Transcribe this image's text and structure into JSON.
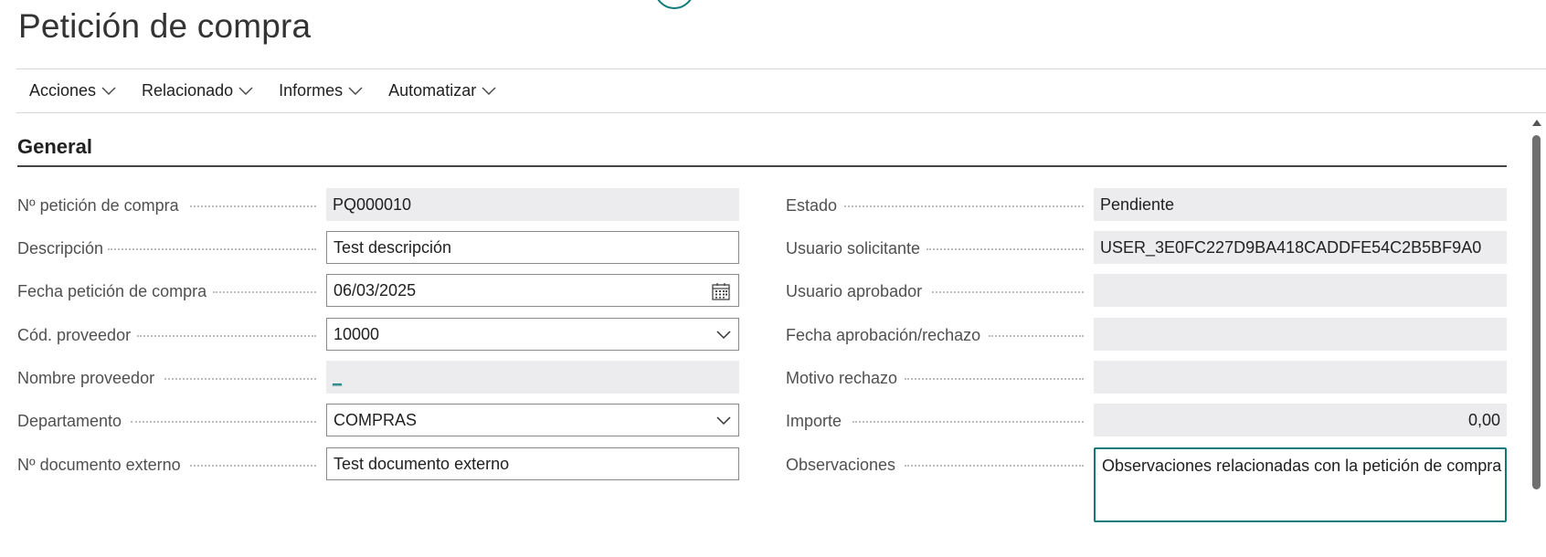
{
  "header": {
    "title": "Petición de compra"
  },
  "menu": [
    {
      "label": "Acciones"
    },
    {
      "label": "Relacionado"
    },
    {
      "label": "Informes"
    },
    {
      "label": "Automatizar"
    }
  ],
  "section": {
    "title": "General"
  },
  "left": [
    {
      "label": "Nº petición de compra",
      "value": "PQ000010",
      "type": "readonly"
    },
    {
      "label": "Descripción",
      "value": "Test descripción",
      "type": "edit"
    },
    {
      "label": "Fecha petición de compra",
      "value": "06/03/2025",
      "type": "date"
    },
    {
      "label": "Cód. proveedor",
      "value": "10000",
      "type": "dropdown"
    },
    {
      "label": "Nombre proveedor",
      "value": "_",
      "type": "readonly-link"
    },
    {
      "label": "Departamento",
      "value": "COMPRAS",
      "type": "dropdown"
    },
    {
      "label": "Nº documento externo",
      "value": "Test documento externo",
      "type": "edit"
    }
  ],
  "right": [
    {
      "label": "Estado",
      "value": "Pendiente",
      "type": "readonly"
    },
    {
      "label": "Usuario solicitante",
      "value": "USER_3E0FC227D9BA418CADDFE54C2B5BF9A0",
      "type": "readonly"
    },
    {
      "label": "Usuario aprobador",
      "value": "",
      "type": "readonly"
    },
    {
      "label": "Fecha aprobación/rechazo",
      "value": "",
      "type": "readonly"
    },
    {
      "label": "Motivo rechazo",
      "value": "",
      "type": "readonly"
    },
    {
      "label": "Importe",
      "value": "0,00",
      "type": "readonly-number"
    },
    {
      "label": "Observaciones",
      "value": "Observaciones relacionadas con la petición de compra",
      "type": "textarea-focused"
    }
  ],
  "icons": {
    "chevron": "chevron-down-icon",
    "calendar": "calendar-icon",
    "scroll_up": "scroll-up-arrow-icon"
  },
  "colors": {
    "accent": "#0f7b78",
    "readonly_bg": "#ececee"
  }
}
